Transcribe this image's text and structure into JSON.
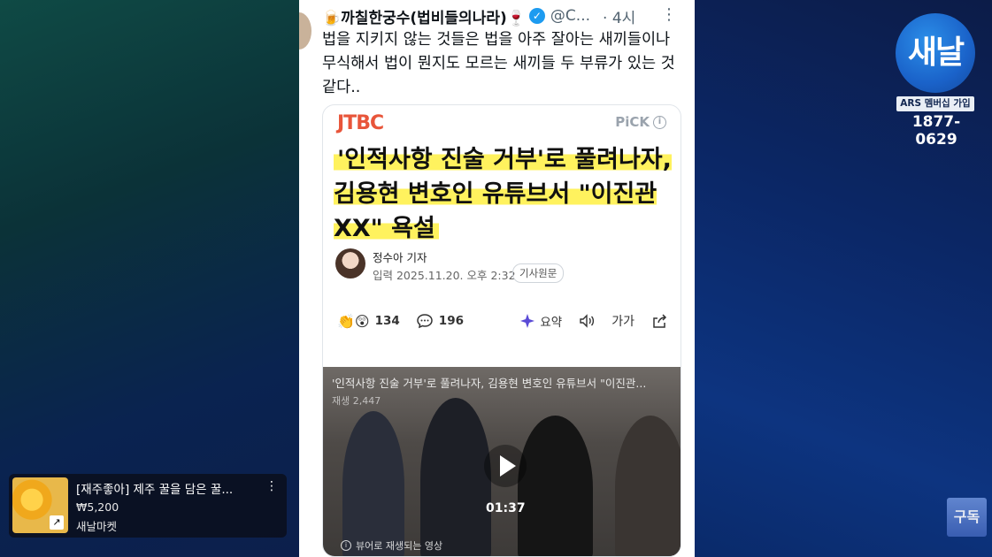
{
  "tweet": {
    "name": "🍺까칠한궁수(법비들의나라)🍷",
    "handle": "@C...",
    "time": "· 4시",
    "more": "⋮",
    "text": "법을 지키지 않는 것들은 법을 아주 잘아는 새끼들이나 무식해서 법이 뭔지도 모르는 새끼들 두 부류가 있는 것 같다.."
  },
  "article": {
    "logo": "JTBC",
    "pick": "PiCK",
    "headline": "'인적사항 진술 거부'로 풀려나자, 김용현 변호인 유튜브서 \"이진관 XX\" 욕설",
    "reporter": "정수아 기자",
    "date": "입력 2025.11.20. 오후 2:32",
    "original_button": "기사원문",
    "reactions": "134",
    "comments": "196",
    "summary": "요약",
    "font_size": "가가"
  },
  "video": {
    "title": "'인적사항 진술 거부'로 풀려나자, 김용현 변호인 유튜브서 \"이진관...",
    "views": "재생 2,447",
    "duration": "01:37",
    "note": "뷰어로 재생되는 영상"
  },
  "logo": {
    "text": "새날",
    "ars": "ARS 멤버십 가입",
    "phone": "1877-0629"
  },
  "ad": {
    "title": "[재주좋아] 제주 꿀을 담은 꿀...",
    "price": "₩5,200",
    "seller": "새날마켓",
    "more": "⋮"
  },
  "subscribe": "구독",
  "colors": {
    "highlight": "#fff25e",
    "verified": "#1d9bf0",
    "jtbc": "#e8553a",
    "brand_blue": "#1a62c9"
  }
}
